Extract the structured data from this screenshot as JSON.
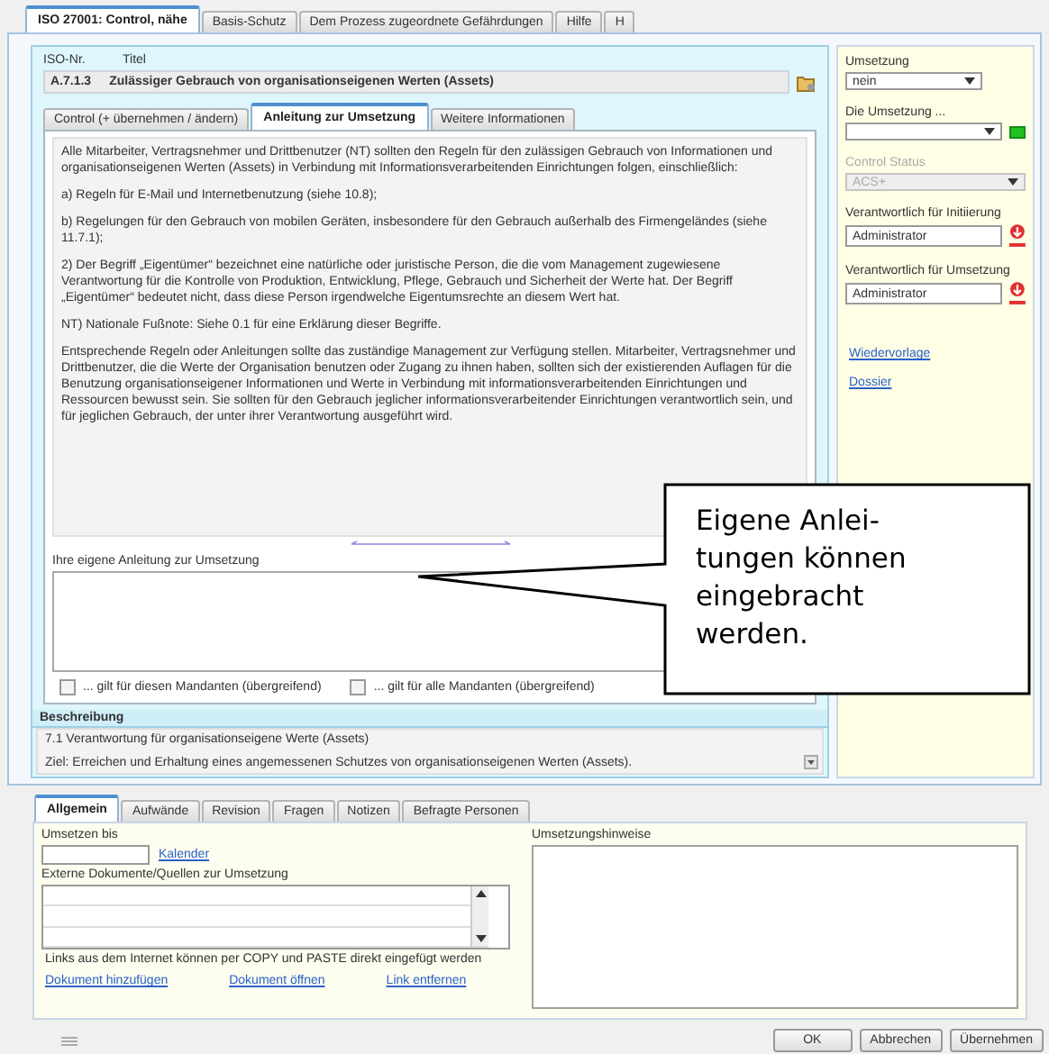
{
  "top_tabs": [
    {
      "label": "ISO 27001: Control, nähe",
      "selected": true
    },
    {
      "label": "Basis-Schutz",
      "selected": false
    },
    {
      "label": "Dem Prozess zugeordnete Gefährdungen",
      "selected": false
    },
    {
      "label": "Hilfe",
      "selected": false
    },
    {
      "label": "H",
      "selected": false
    }
  ],
  "control": {
    "iso_label": "ISO-Nr.",
    "title_label": "Titel",
    "iso_nr": "A.7.1.3",
    "title": "Zulässiger Gebrauch von organisationseigenen Werten (Assets)"
  },
  "inner_tabs": [
    {
      "label": "Control (+ übernehmen / ändern)",
      "selected": false
    },
    {
      "label": "Anleitung zur Umsetzung",
      "selected": true
    },
    {
      "label": "Weitere Informationen",
      "selected": false
    }
  ],
  "guidance": {
    "paragraphs": [
      "Alle Mitarbeiter, Vertragsnehmer und Drittbenutzer (NT) sollten den Regeln für den zulässigen Gebrauch von Informationen und organisationseigenen Werten (Assets) in Verbindung mit Informationsverarbeitenden Einrichtungen folgen, einschließlich:",
      "a) Regeln für E-Mail und Internetbenutzung (siehe 10.8);",
      "b) Regelungen für den Gebrauch von mobilen Geräten, insbesondere für den Gebrauch außerhalb des Firmengeländes (siehe 11.7.1);",
      "2) Der Begriff „Eigentümer“ bezeichnet eine natürliche oder juristische Person, die die vom Management zugewiesene Verantwortung für die Kontrolle von Produktion, Entwicklung, Pflege, Gebrauch und Sicherheit der Werte hat. Der Begriff „Eigentümer“ bedeutet nicht, dass diese Person irgendwelche Eigentumsrechte an diesem Wert hat.",
      "NT) Nationale Fußnote: Siehe 0.1 für eine Erklärung dieser Begriffe.",
      "Entsprechende Regeln oder Anleitungen sollte das zuständige Management zur Verfügung stellen. Mitarbeiter, Vertragsnehmer und Drittbenutzer, die die Werte der Organisation benutzen oder Zugang zu ihnen haben, sollten sich der existierenden Auflagen für die Benutzung organisationseigener Informationen und Werte in Verbindung mit informationsverarbeitenden Einrichtungen und Ressourcen bewusst sein. Sie sollten für den Gebrauch jeglicher informationsverarbeitender Einrichtungen verantwortlich sein, und für jeglichen Gebrauch, der unter ihrer Verantwortung ausgeführt wird."
    ]
  },
  "own_guidance": {
    "label": "Ihre eigene Anleitung zur Umsetzung",
    "checkboxes": [
      {
        "label": "... gilt für diesen Mandanten (übergreifend)",
        "checked": false
      },
      {
        "label": "... gilt für alle Mandanten (übergreifend)",
        "checked": false
      }
    ]
  },
  "description": {
    "heading": "Beschreibung",
    "paragraphs": [
      "7.1 Verantwortung für organisationseigene Werte (Assets)",
      "Ziel: Erreichen und Erhaltung eines angemessenen Schutzes von organisationseigenen Werten (Assets)."
    ]
  },
  "side_panel": {
    "fields": [
      {
        "kind": "select",
        "label": "Umsetzung",
        "value": "nein",
        "disabled": false
      },
      {
        "kind": "select",
        "label": "Die Umsetzung ...",
        "disabled": false
      },
      {
        "kind": "select",
        "label": "Control Status",
        "value": "ACS+",
        "disabled": true
      },
      {
        "kind": "person",
        "label": "Verantwortlich für Initiierung",
        "value": "Administrator",
        "disabled": false
      },
      {
        "kind": "person",
        "label": "Verantwortlich für Umsetzung",
        "value": "Administrator",
        "disabled": false
      }
    ],
    "links": [
      "Wiedervorlage",
      "Dossier"
    ]
  },
  "callout": {
    "text": "Eigene Anlei-\ntungen können\neingebracht\nwerden."
  },
  "bottom_tabs": [
    {
      "label": "Allgemein",
      "selected": true
    },
    {
      "label": "Aufwände",
      "selected": false
    },
    {
      "label": "Revision",
      "selected": false
    },
    {
      "label": "Fragen",
      "selected": false
    },
    {
      "label": "Notizen",
      "selected": false
    },
    {
      "label": "Befragte Personen",
      "selected": false
    }
  ],
  "details": {
    "due_label": "Umsetzen bis",
    "calendar_link": "Kalender",
    "documents_label": "Externe Dokumente/Quellen zur Umsetzung",
    "hint": "Links aus dem Internet können per COPY und PASTE direkt eingefügt werden",
    "actions": [
      "Dokument hinzufügen",
      "Dokument öffnen",
      "Link entfernen"
    ],
    "notes_label": "Umsetzungshinweise"
  },
  "buttons": [
    "OK",
    "Abbrechen",
    "Übernehmen"
  ]
}
